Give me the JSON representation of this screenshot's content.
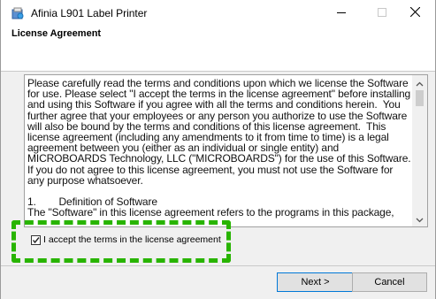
{
  "window": {
    "title": "Afinia L901 Label Printer",
    "icon": "installer-icon",
    "controls": {
      "minimize": "minimize-icon",
      "maximize": "maximize-icon",
      "close": "close-icon"
    }
  },
  "header": {
    "title": "License Agreement"
  },
  "license": {
    "text": "Please carefully read the terms and conditions upon which we license the Software for use. Please select \"I accept the terms in the license agreement\" before installing and using this Software if you agree with all the terms and conditions herein.  You further agree that your employees or any person you authorize to use the Software will also be bound by the terms and conditions of this license agreement.  This license agreement (including any amendments to it from time to time) is a legal agreement between you (either as an individual or single entity) and MICROBOARDS Technology, LLC (\"MICROBOARDS\") for the use of this Software.  If you do not agree to this license agreement, you must not use the Software for any purpose whatsoever.\n\n1.        Definition of Software\nThe \"Software\" in this license agreement refers to the programs in this package,"
  },
  "accept": {
    "label": "I accept the terms in the license agreement",
    "checked": true
  },
  "buttons": {
    "next": "Next >",
    "cancel": "Cancel"
  },
  "colors": {
    "highlight": "#28b400",
    "focus_border": "#0078d7"
  }
}
